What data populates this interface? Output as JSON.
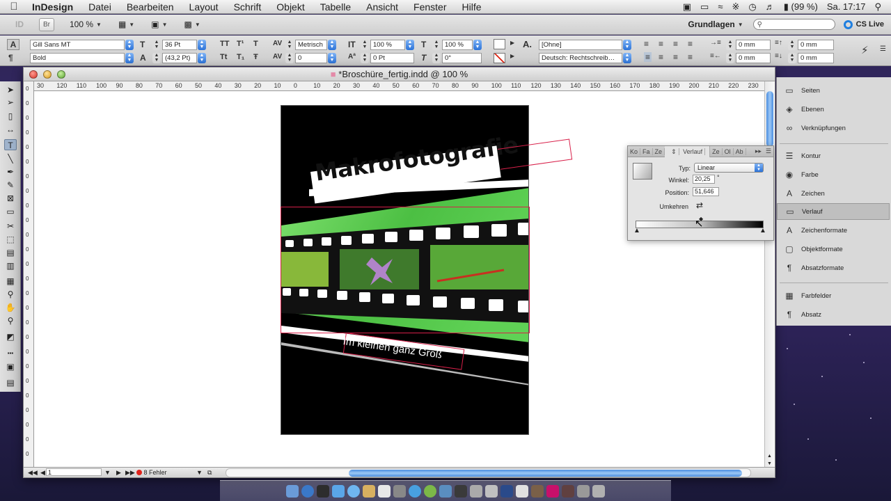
{
  "menubar": {
    "app": "InDesign",
    "items": [
      "Datei",
      "Bearbeiten",
      "Layout",
      "Schrift",
      "Objekt",
      "Tabelle",
      "Ansicht",
      "Fenster",
      "Hilfe"
    ],
    "battery": "(99 %)",
    "clock": "Sa. 17:17"
  },
  "appbar": {
    "app_icon": "ID",
    "bridge_button": "Br",
    "zoom": "100 %",
    "workspace": "Grundlagen",
    "search_placeholder": "",
    "cs_live": "CS Live"
  },
  "control": {
    "font_family": "Gill Sans MT",
    "font_style": "Bold",
    "font_size": "36 Pt",
    "leading": "(43,2 Pt)",
    "kerning": "Metrisch",
    "tracking": "0",
    "vertical_scale": "100 %",
    "horizontal_scale": "100 %",
    "baseline_shift": "0 Pt",
    "skew": "0°",
    "char_style": "[Ohne]",
    "language": "Deutsch: Rechtschreib…",
    "left_indent": "0 mm",
    "right_indent": "0 mm",
    "space_before": "0 mm",
    "space_after": "0 mm"
  },
  "document": {
    "title": "*Broschüre_fertig.indd @ 100 %",
    "ruler_labels": [
      "30",
      "120",
      "110",
      "100",
      "90",
      "80",
      "70",
      "60",
      "50",
      "40",
      "30",
      "20",
      "10",
      "0",
      "10",
      "20",
      "30",
      "40",
      "50",
      "60",
      "70",
      "80",
      "90",
      "100",
      "110",
      "120",
      "130",
      "140",
      "150",
      "160",
      "170",
      "180",
      "190",
      "200",
      "210",
      "220",
      "230"
    ],
    "page_number": "1",
    "errors": "8 Fehler",
    "headline": "Makrofotografie",
    "subline": "Im kleinen ganz Groß"
  },
  "gradient_panel": {
    "tabs": [
      "Ko",
      "Fa",
      "Ze"
    ],
    "active_tab": "Verlauf",
    "tabs_after": [
      "Ze",
      "Ol",
      "Ab"
    ],
    "type_label": "Typ:",
    "type_value": "Linear",
    "angle_label": "Winkel:",
    "angle_value": "20,25",
    "angle_unit": "°",
    "position_label": "Position:",
    "position_value": "51,646",
    "reverse_label": "Umkehren",
    "stop_position": 51.646
  },
  "dock_panels": {
    "group1": [
      "Seiten",
      "Ebenen",
      "Verknüpfungen"
    ],
    "group2": [
      "Kontur",
      "Farbe",
      "Zeichen",
      "Verlauf",
      "Zeichenformate",
      "Objektformate",
      "Absatzformate"
    ],
    "group3": [
      "Farbfelder",
      "Absatz"
    ],
    "selected": "Verlauf"
  },
  "colors": {
    "accent": "#2c73d8",
    "film_green": "#58c94e",
    "selection": "#d8204a"
  }
}
